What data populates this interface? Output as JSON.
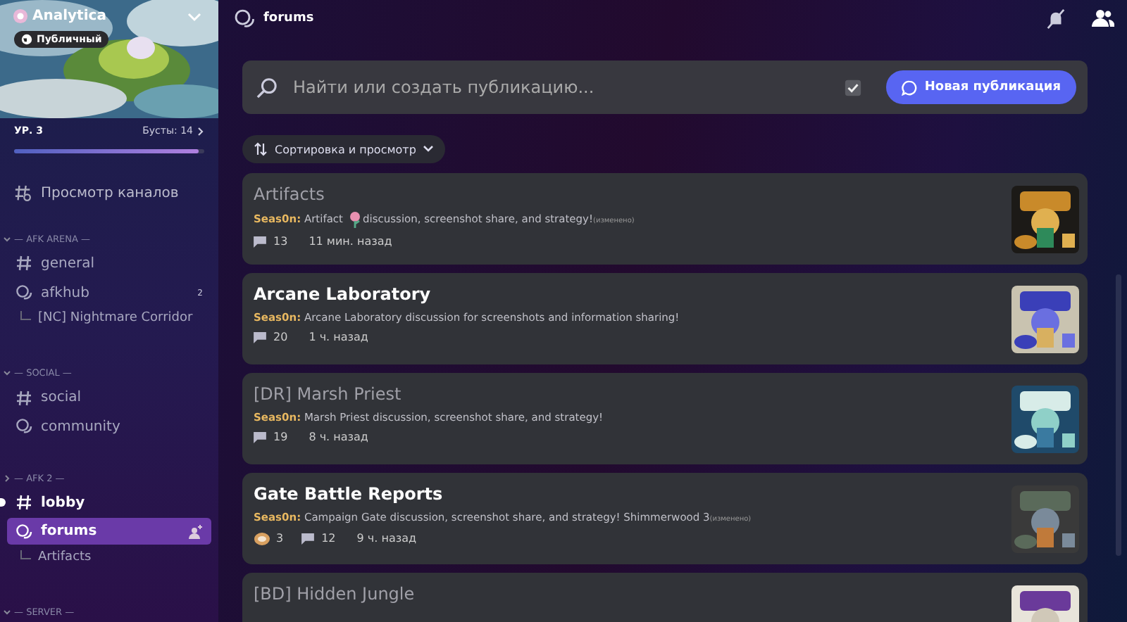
{
  "server": {
    "name": "Analytica",
    "badge": "Публичный",
    "level": "УР. 3",
    "boosts": "Бусты: 14",
    "progress": {
      "level": 0.97
    }
  },
  "browse_channels": "Просмотр каналов",
  "categories": [
    {
      "name": "— AFK ARENA —",
      "expanded": true,
      "channels": [
        {
          "kind": "text",
          "name": "general",
          "unread": false,
          "selected": false
        },
        {
          "kind": "forum",
          "name": "afkhub",
          "unread": false,
          "selected": false,
          "badge": "2",
          "children": [
            {
              "name": "[NC] Nightmare Corridor",
              "selected": false
            }
          ]
        }
      ]
    },
    {
      "name": "— SOCIAL —",
      "expanded": true,
      "channels": [
        {
          "kind": "text",
          "name": "social",
          "unread": false,
          "selected": false
        },
        {
          "kind": "forum",
          "name": "community",
          "unread": false,
          "selected": false
        }
      ]
    },
    {
      "name": "— AFK 2 —",
      "expanded": false,
      "channels": [
        {
          "kind": "text",
          "name": "lobby",
          "unread": true,
          "selected": false
        },
        {
          "kind": "forum",
          "name": "forums",
          "unread": true,
          "selected": true,
          "children": [
            {
              "name": "Artifacts",
              "selected": false
            }
          ]
        }
      ]
    },
    {
      "name": "— SERVER —",
      "expanded": true
    }
  ],
  "header": {
    "channel": "forums"
  },
  "search": {
    "placeholder": "Найти или создать публикацию..."
  },
  "new_post_button": "Новая публикация",
  "sort_button": "Сортировка и просмотр",
  "posts": [
    {
      "title": "Artifacts",
      "read": true,
      "author": "Seas0n:",
      "text": "Artifact",
      "inline_emoji": true,
      "text_after": "discussion, screenshot share, and strategy!",
      "edited": "(изменено)",
      "comments": "13",
      "time": "11 мин. назад"
    },
    {
      "title": "Arcane Laboratory",
      "read": false,
      "author": "Seas0n:",
      "text": "Arcane Laboratory discussion for screenshots and information sharing!",
      "inline_emoji": false,
      "comments": "20",
      "time": "1 ч. назад"
    },
    {
      "title": "[DR] Marsh Priest",
      "read": true,
      "author": "Seas0n:",
      "text": "Marsh Priest discussion, screenshot share, and strategy!",
      "inline_emoji": false,
      "comments": "19",
      "time": "8 ч. назад"
    },
    {
      "title": "Gate Battle Reports",
      "read": false,
      "author": "Seas0n:",
      "text": "Campaign Gate discussion, screenshot share, and strategy! Shimmerwood 3",
      "inline_emoji": false,
      "edited": "(изменено)",
      "reaction": "3",
      "comments": "12",
      "time": "9 ч. назад"
    },
    {
      "title": "[BD] Hidden Jungle",
      "read": true
    }
  ]
}
